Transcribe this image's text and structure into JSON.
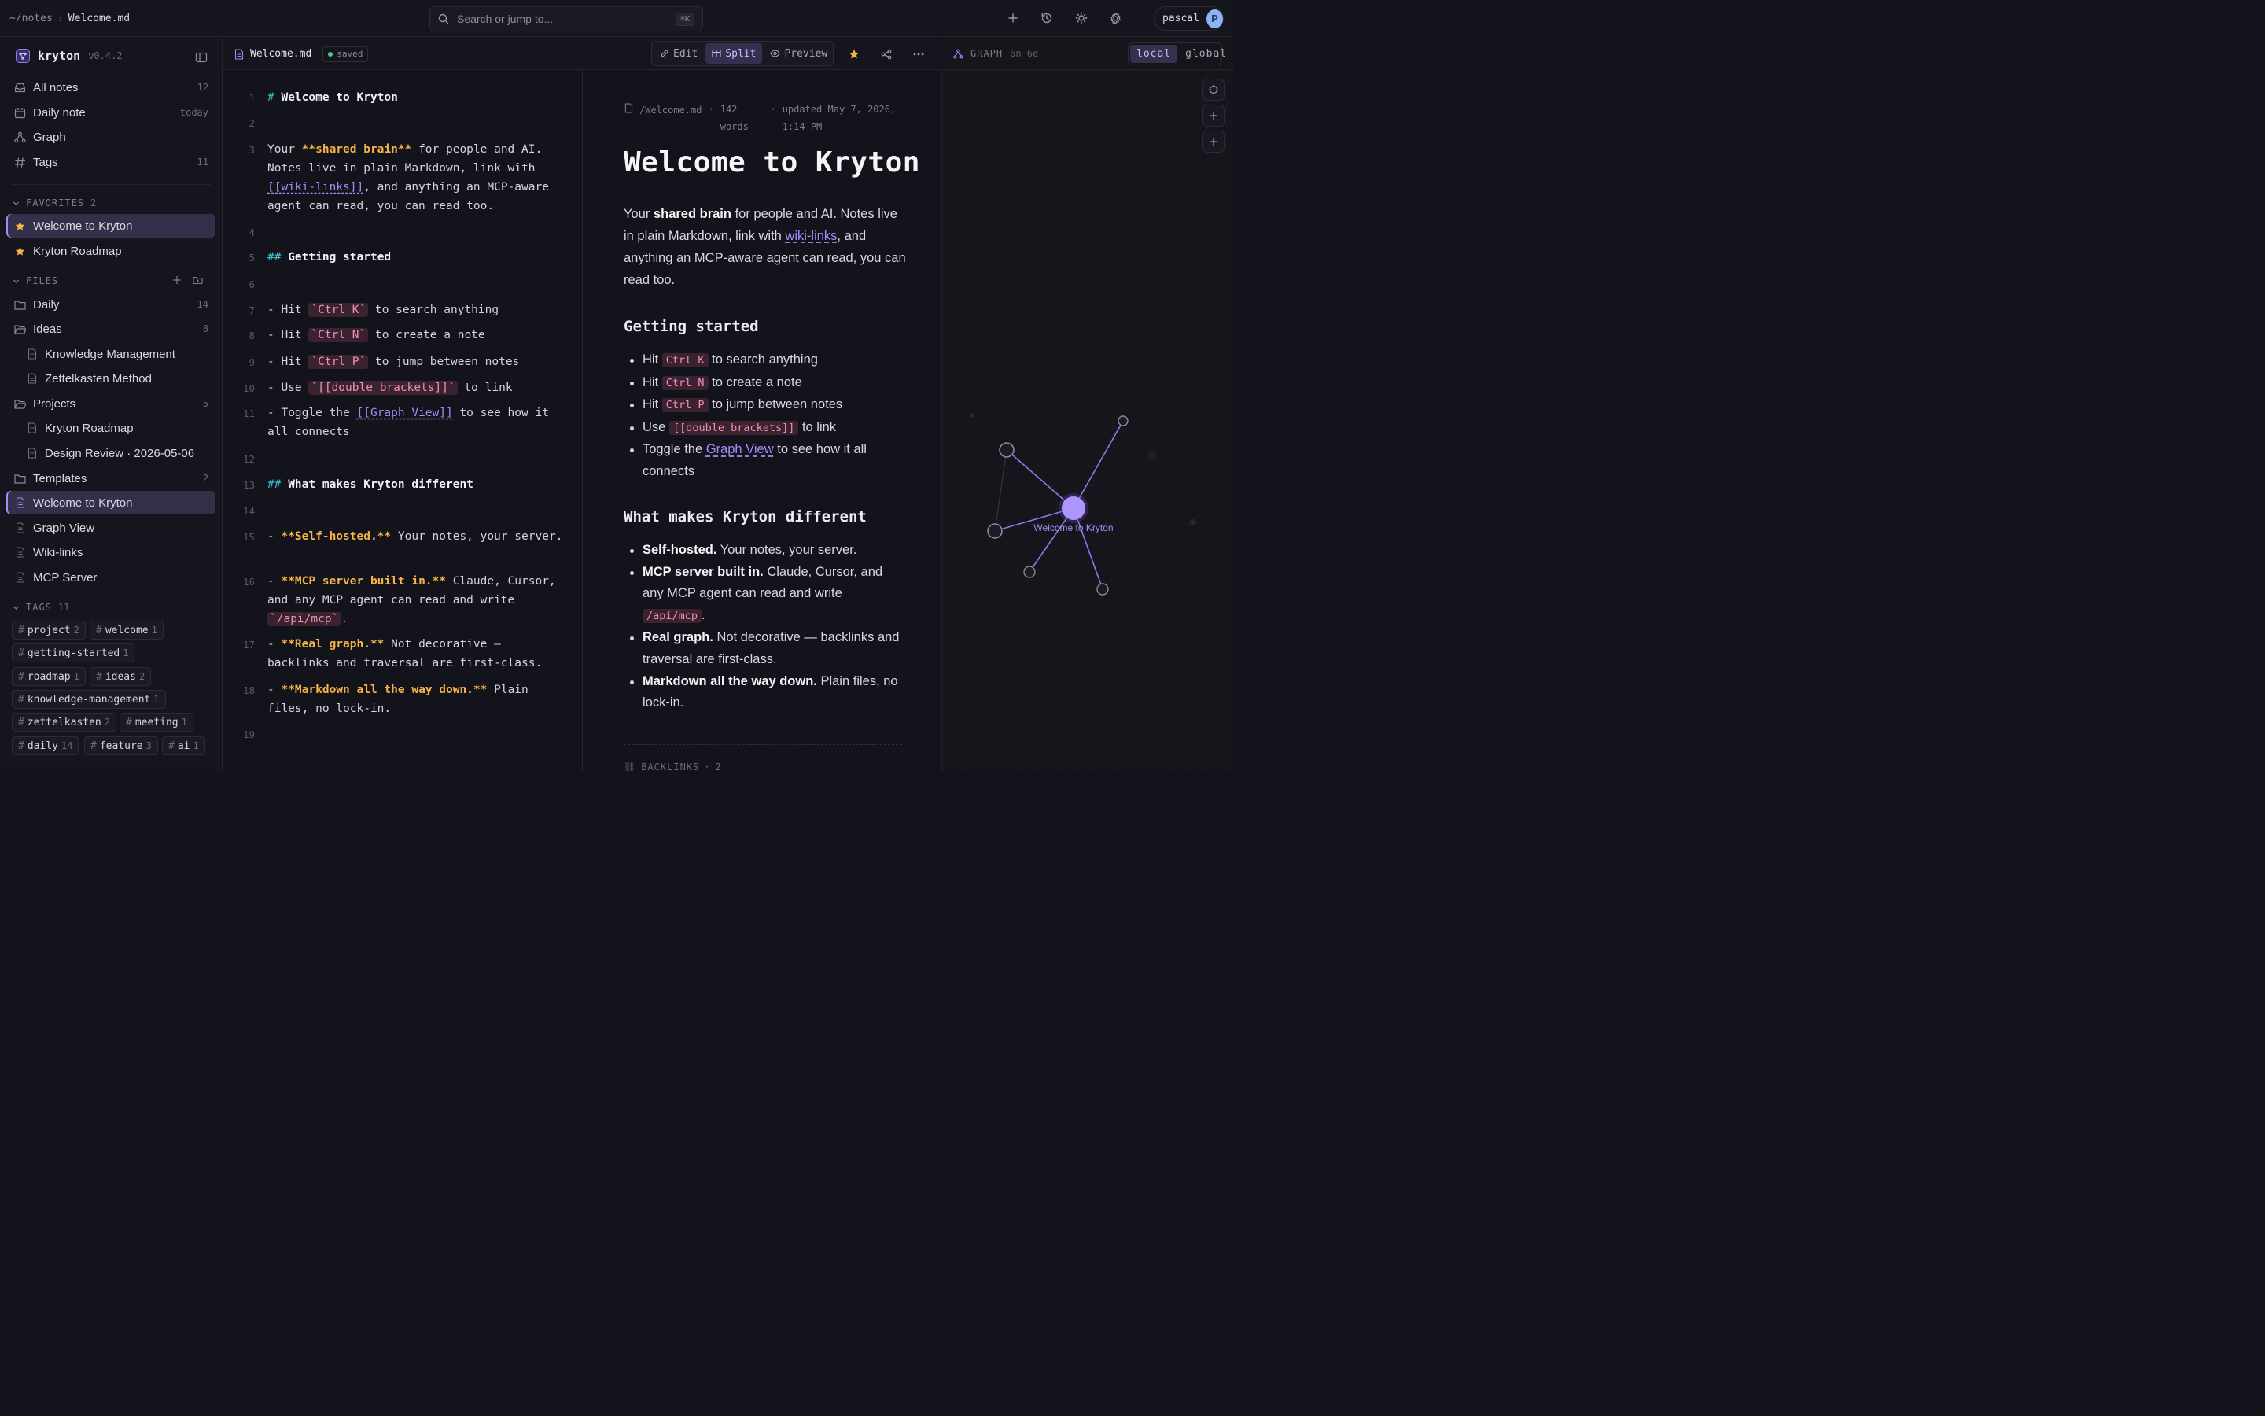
{
  "topbar": {
    "breadcrumb_root": "~/notes",
    "breadcrumb_file": "Welcome.md",
    "search_placeholder": "Search or jump to...",
    "search_shortcut": "⌘K",
    "user_name": "pascal",
    "user_initial": "P"
  },
  "brand": {
    "name": "kryton",
    "version": "v0.4.2"
  },
  "nav": [
    {
      "label": "All notes",
      "count": "12",
      "icon": "inbox-icon"
    },
    {
      "label": "Daily note",
      "count": "today",
      "icon": "calendar-icon"
    },
    {
      "label": "Graph",
      "count": "",
      "icon": "graph-icon"
    },
    {
      "label": "Tags",
      "count": "11",
      "icon": "hash-icon"
    }
  ],
  "favorites": {
    "title": "FAVORITES",
    "count": "2",
    "items": [
      "Welcome to Kryton",
      "Kryton Roadmap"
    ]
  },
  "files": {
    "title": "FILES",
    "items": [
      {
        "label": "Daily",
        "count": "14"
      },
      {
        "label": "Ideas",
        "count": "8"
      },
      {
        "label": "Knowledge Management"
      },
      {
        "label": "Zettelkasten Method"
      },
      {
        "label": "Projects",
        "count": "5"
      },
      {
        "label": "Kryton Roadmap"
      },
      {
        "label": "Design Review · 2026-05-06"
      },
      {
        "label": "Templates",
        "count": "2"
      },
      {
        "label": "Welcome to Kryton"
      },
      {
        "label": "Graph View"
      },
      {
        "label": "Wiki-links"
      },
      {
        "label": "MCP Server"
      }
    ]
  },
  "tags": {
    "title": "TAGS",
    "count": "11",
    "items": [
      {
        "name": "project",
        "count": "2"
      },
      {
        "name": "welcome",
        "count": "1"
      },
      {
        "name": "getting-started",
        "count": "1"
      },
      {
        "name": "roadmap",
        "count": "1"
      },
      {
        "name": "ideas",
        "count": "2"
      },
      {
        "name": "knowledge-management",
        "count": "1"
      },
      {
        "name": "zettelkasten",
        "count": "2"
      },
      {
        "name": "meeting",
        "count": "1"
      },
      {
        "name": "daily",
        "count": "14"
      },
      {
        "name": "feature",
        "count": "3"
      },
      {
        "name": "ai",
        "count": "1"
      }
    ]
  },
  "editor": {
    "tab_name": "Welcome.md",
    "status": "saved",
    "modes": [
      "Edit",
      "Split",
      "Preview"
    ],
    "active_mode": "Split",
    "lines": [
      {
        "n": "1"
      },
      {
        "n": "2"
      },
      {
        "n": "3"
      },
      {
        "n": "4"
      },
      {
        "n": "5"
      },
      {
        "n": "6"
      },
      {
        "n": "7"
      },
      {
        "n": "8"
      },
      {
        "n": "9"
      },
      {
        "n": "10"
      },
      {
        "n": "11"
      },
      {
        "n": "12"
      },
      {
        "n": "13"
      },
      {
        "n": "14"
      },
      {
        "n": "15"
      },
      {
        "n": "16"
      },
      {
        "n": "17"
      },
      {
        "n": "18"
      },
      {
        "n": "19"
      }
    ],
    "md": {
      "h_mark": "#",
      "h2_mark": "##",
      "title": "Welcome to Kryton",
      "l3_a": "Your ",
      "l3_b": "**shared brain**",
      "l3_c": " for people and AI. Notes live in plain Markdown, link with ",
      "l3_d": "[[wiki-links]]",
      "l3_e": ", and anything an MCP-aware agent can read, you can read too.",
      "h2_getting": "Getting started",
      "bullet": "- ",
      "hit": "Hit ",
      "use": "Use ",
      "toggle": "Toggle the ",
      "k_ctrlk": "`Ctrl K`",
      "k_ctrln": "`Ctrl N`",
      "k_ctrlp": "`Ctrl P`",
      "k_brackets": "`[[double brackets]]`",
      "t_search": " to search anything",
      "t_create": " to create a note",
      "t_jump": " to jump between notes",
      "t_link": " to link",
      "graph_link": "[[Graph View]]",
      "t_connects": " to see how it all connects",
      "h2_diff": "What makes Kryton different",
      "b15": "**Self-hosted.**",
      "t15": " Your notes, your server.",
      "b16": "**MCP server built in.**",
      "t16": " Claude, Cursor, and any MCP agent can read and write ",
      "k16": "`/api/mcp`",
      "dot": ".",
      "b17": "**Real graph.**",
      "t17": " Not decorative — backlinks and traversal are first-class.",
      "b18": "**Markdown all the way down.**",
      "t18": " Plain files, no lock-in."
    }
  },
  "preview": {
    "path": "/Welcome.md",
    "words": "142 words",
    "updated": "updated May 7, 2026, 1:14 PM",
    "sep": "·",
    "title": "Welcome to Kryton",
    "intro_a": "Your ",
    "intro_b": "shared brain",
    "intro_c": " for people and AI. Notes live in plain Markdown, link with ",
    "intro_link": "wiki-links",
    "intro_d": ", and anything an MCP-aware agent can read, you can read too.",
    "h_getting": "Getting started",
    "hit": "Hit ",
    "use": "Use ",
    "toggle": "Toggle the ",
    "k_ctrlk": "Ctrl K",
    "k_ctrln": "Ctrl N",
    "k_ctrlp": "Ctrl P",
    "k_brackets": "[[double brackets]]",
    "t_search": " to search anything",
    "t_create": " to create a note",
    "t_jump": " to jump between notes",
    "t_link": " to link",
    "graph_link": "Graph View",
    "t_connects": " to see how it all connects",
    "h_diff": "What makes Kryton different",
    "b1": "Self-hosted.",
    "t1": " Your notes, your server.",
    "b2": "MCP server built in.",
    "t2": " Claude, Cursor, and any MCP agent can read and write ",
    "k2": "/api/mcp",
    "dot": ".",
    "b3": "Real graph.",
    "t3": " Not decorative — backlinks and traversal are first-class.",
    "b4": "Markdown all the way down.",
    "t4": " Plain files, no lock-in.",
    "backlinks_label": "BACKLINKS",
    "backlinks_count": "2"
  },
  "graph": {
    "title": "GRAPH",
    "stats": "6n 6e",
    "scopes": [
      "local",
      "global"
    ],
    "active_scope": "local",
    "center_label": "Welcome to Kryton",
    "accent": "#a48cf7"
  }
}
